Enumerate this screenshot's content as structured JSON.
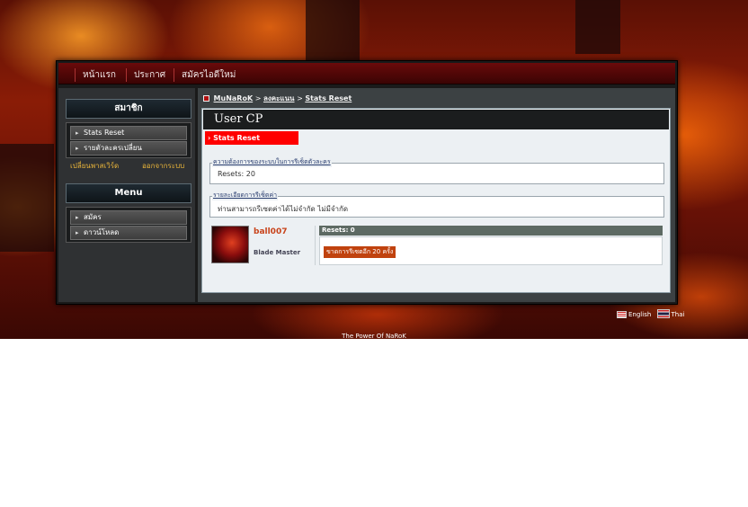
{
  "nav": {
    "items": [
      {
        "label": "หน้าแรก"
      },
      {
        "label": "ประกาศ"
      },
      {
        "label": "สมัครไอดีใหม่"
      }
    ]
  },
  "sidebar": {
    "member_title": "สมาชิก",
    "member_items": [
      {
        "label": "Stats Reset"
      },
      {
        "label": "รายตัวละครเปลี่ยน"
      }
    ],
    "member_links": {
      "left": "เปลี่ยนพาสเวิร์ด",
      "right": "ออกจากระบบ"
    },
    "menu_title": "Menu",
    "menu_items": [
      {
        "label": "สมัคร"
      },
      {
        "label": "ดาวน์โหลด"
      }
    ]
  },
  "breadcrumb": {
    "items": [
      "MuNaRoK",
      "ลงคะแนน",
      "Stats Reset"
    ],
    "separator": ">"
  },
  "main": {
    "title": "User CP",
    "active_tab": "Stats Reset",
    "section1": {
      "legend": "ความต้องการของระบบในการรีเซ็ตตัวละคร",
      "value": "Resets: 20"
    },
    "section2": {
      "legend": "รายละเอียดการรีเซ็ตค่า",
      "value": "ท่านสามารถรีเซตค่าได้ไม่จำกัด ไม่มีจำกัด"
    },
    "character": {
      "name": "ball007",
      "class": "Blade Master",
      "resets_label": "Resets: 0",
      "status": "ขาดการรีเซตอีก 20 ครั้ง"
    }
  },
  "languages": [
    {
      "label": "English",
      "icon": "flag-en-icon"
    },
    {
      "label": "Thai",
      "icon": "flag-th-icon"
    }
  ],
  "footer": {
    "text": "The Power Of NaRoK"
  },
  "colors": {
    "nav_bg": "#6a0a0a",
    "active_tab": "#ff0000",
    "accent_orange": "#c8431a",
    "panel_dark": "#1b1d1e"
  }
}
